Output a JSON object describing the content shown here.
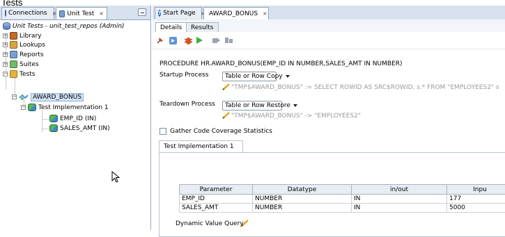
{
  "window_title": "Tests",
  "left_tabs": [
    {
      "label": "Connections",
      "active": false
    },
    {
      "label": "Unit Test",
      "active": true
    }
  ],
  "tree": {
    "root": "Unit Tests - unit_test_repos (Admin)",
    "nodes": [
      "Library",
      "Lookups",
      "Reports",
      "Suites",
      "Tests"
    ],
    "test": "AWARD_BONUS",
    "implementation": "Test Implementation 1",
    "params": [
      "EMP_ID (IN)",
      "SALES_AMT (IN)"
    ]
  },
  "editor_tabs": [
    {
      "label": "Start Page",
      "active": false
    },
    {
      "label": "AWARD_BONUS",
      "active": true
    }
  ],
  "sub_tabs": [
    {
      "label": "Details",
      "active": true
    },
    {
      "label": "Results",
      "active": false
    }
  ],
  "toolbar_icons": [
    "pin-icon",
    "run-icon",
    "debug-icon",
    "play-icon",
    "grey-action-icon-1",
    "grey-action-icon-2"
  ],
  "procedure": "PROCEDURE HR.AWARD_BONUS(EMP_ID IN NUMBER,SALES_AMT IN NUMBER)",
  "startup": {
    "label": "Startup Process",
    "value": "Table or Row Copy",
    "detail": "\"TMP$AWARD_BONUS\" := SELECT ROWID AS SRC$ROWID, s.* FROM \"EMPLOYEES2\" s"
  },
  "teardown": {
    "label": "Teardown Process",
    "value": "Table or Row Restore",
    "detail": "\"TMP$AWARD_BONUS\" -> \"EMPLOYEES2\""
  },
  "coverage_label": "Gather Code Coverage Statistics",
  "impl_tab": "Test Implementation 1",
  "table": {
    "headers": [
      "Parameter",
      "Datatype",
      "in/out",
      "Inpu"
    ],
    "rows": [
      [
        "EMP_ID",
        "NUMBER",
        "IN",
        "177"
      ],
      [
        "SALES_AMT",
        "NUMBER",
        "IN",
        "5000"
      ]
    ]
  },
  "dynamic_query_label": "Dynamic Value Query",
  "colors": {
    "tab_strip": "#d8e1ee",
    "selection": "#d3e2f6",
    "pencil": "#e7a21a"
  }
}
